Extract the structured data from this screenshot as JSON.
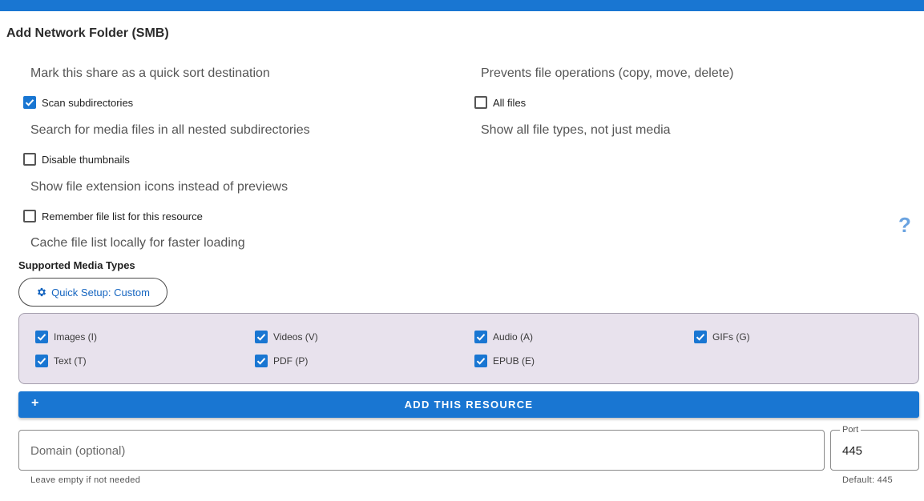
{
  "page": {
    "title": "Add Network Folder (SMB)"
  },
  "options": {
    "quick_sort_desc": "Mark this share as a quick sort destination",
    "read_only_desc": "Prevents file operations (copy, move, delete)",
    "scan_subdirectories": {
      "label": "Scan subdirectories",
      "checked": true,
      "desc": "Search for media files in all nested subdirectories"
    },
    "all_files": {
      "label": "All files",
      "checked": false,
      "desc": "Show all file types, not just media"
    },
    "disable_thumbnails": {
      "label": "Disable thumbnails",
      "checked": false,
      "desc": "Show file extension icons instead of previews"
    },
    "remember_file_list": {
      "label": "Remember file list for this resource",
      "checked": false,
      "desc": "Cache file list locally for faster loading"
    }
  },
  "help_icon": {
    "icon": "help-icon",
    "glyph": "?"
  },
  "media_types": {
    "section_label": "Supported Media Types",
    "quick_setup_label": "Quick Setup: Custom",
    "quick_setup_icon": "gear-icon",
    "items": [
      {
        "label": "Images (I)",
        "checked": true
      },
      {
        "label": "Videos (V)",
        "checked": true
      },
      {
        "label": "Audio (A)",
        "checked": true
      },
      {
        "label": "GIFs (G)",
        "checked": true
      },
      {
        "label": "Text (T)",
        "checked": true
      },
      {
        "label": "PDF (P)",
        "checked": true
      },
      {
        "label": "EPUB (E)",
        "checked": true
      }
    ]
  },
  "add_button": {
    "icon": "+",
    "label": "ADD THIS RESOURCE"
  },
  "domain": {
    "placeholder": "Domain (optional)",
    "value": "",
    "helper": "Leave empty if not needed"
  },
  "port": {
    "label": "Port",
    "value": "445",
    "helper": "Default: 445"
  },
  "colors": {
    "accent": "#1976d2",
    "panel_bg": "#e8e2ed",
    "help_icon": "#6aa3e0"
  }
}
